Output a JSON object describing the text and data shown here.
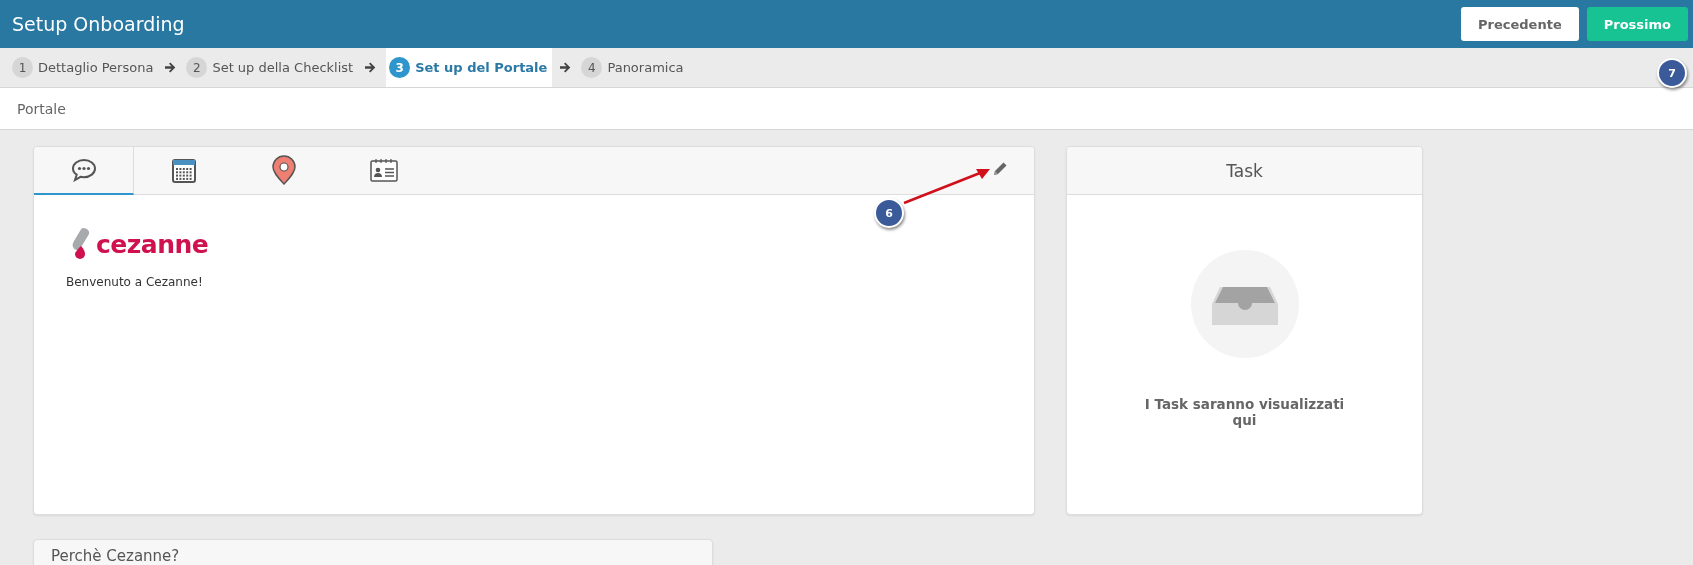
{
  "header": {
    "title": "Setup Onboarding",
    "callout": "7",
    "buttons": [
      {
        "label": "Precedente",
        "kind": "secondary"
      },
      {
        "label": "Prossimo",
        "kind": "primary"
      }
    ]
  },
  "steps": [
    {
      "number": "1",
      "label": "Dettaglio Persona",
      "selected": false
    },
    {
      "number": "2",
      "label": "Set up della Checklist",
      "selected": false
    },
    {
      "number": "3",
      "label": "Set up del Portale",
      "selected": true
    },
    {
      "number": "4",
      "label": "Panoramica",
      "selected": false
    }
  ],
  "section_title": "Portale",
  "portal_card": {
    "tabs": [
      {
        "kind": "chat",
        "selected": true
      },
      {
        "kind": "calendar",
        "selected": false
      },
      {
        "kind": "location",
        "selected": false
      },
      {
        "kind": "contact",
        "selected": false
      }
    ],
    "logo_text": "cezanne",
    "welcome": "Benvenuto a Cezanne!",
    "callout": "6"
  },
  "task_card": {
    "title": "Task",
    "empty_message": "I Task saranno visualizzati qui"
  },
  "next_card": {
    "title": "Perchè Cezanne?"
  }
}
